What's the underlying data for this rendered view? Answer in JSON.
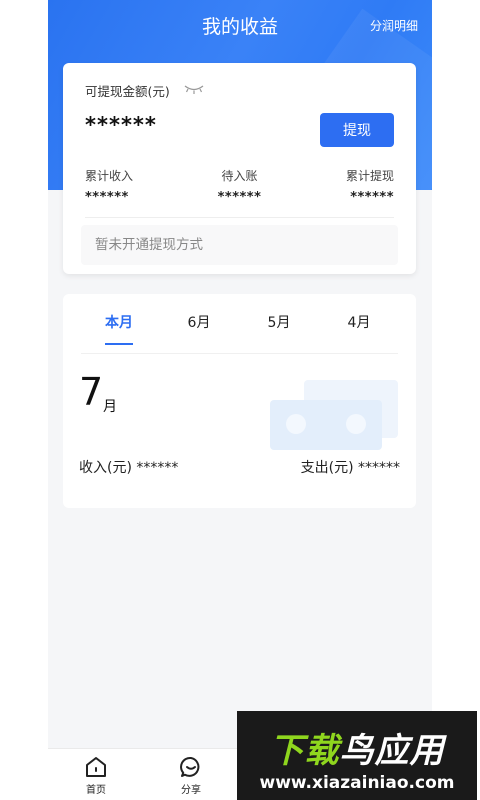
{
  "header": {
    "title": "我的收益",
    "detail_link": "分润明细"
  },
  "balance": {
    "label": "可提现金额(元)",
    "value": "******",
    "withdraw_button": "提现",
    "stats": [
      {
        "label": "累计收入",
        "value": "******"
      },
      {
        "label": "待入账",
        "value": "******"
      },
      {
        "label": "累计提现",
        "value": "******"
      }
    ],
    "method_placeholder": "暂未开通提现方式"
  },
  "monthly": {
    "tabs": [
      "本月",
      "6月",
      "5月",
      "4月"
    ],
    "active_tab": 0,
    "month_number": "7",
    "month_unit": "月",
    "income": "收入(元) ******",
    "expense": "支出(元) ******"
  },
  "bottom_nav": {
    "items": [
      {
        "label": "首页"
      },
      {
        "label": "分享"
      }
    ]
  },
  "watermark": {
    "title_green": "下载",
    "title_white": "鸟应用",
    "url": "www.xiazainiao.com"
  },
  "colors": {
    "primary": "#2d6ef2",
    "header": "#3a82f7",
    "watermark_green": "#8fd61e"
  }
}
